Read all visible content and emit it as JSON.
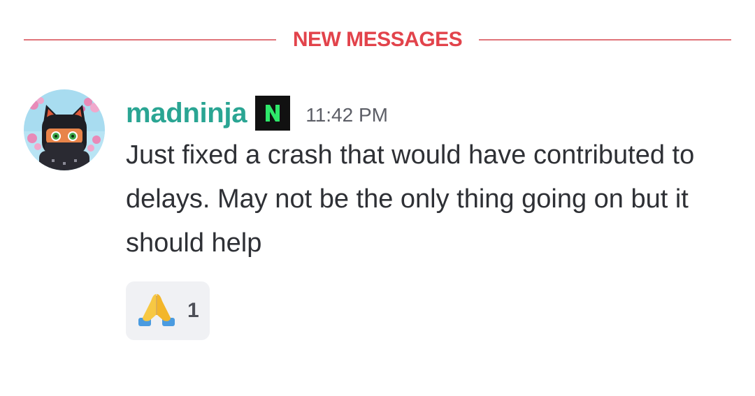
{
  "divider": {
    "label": "NEW MESSAGES",
    "color": "#e2434b"
  },
  "message": {
    "author": {
      "username": "madninja",
      "name_color": "#2aa593",
      "avatar_icon": "ninja-cat-avatar-icon",
      "badge_icon": "n-badge-icon"
    },
    "timestamp": "11:42 PM",
    "text": "Just fixed a crash that would have contributed to delays. May not be the only thing going on but it should help",
    "reactions": [
      {
        "emoji_icon": "folded-hands-emoji-icon",
        "count": "1"
      }
    ]
  }
}
